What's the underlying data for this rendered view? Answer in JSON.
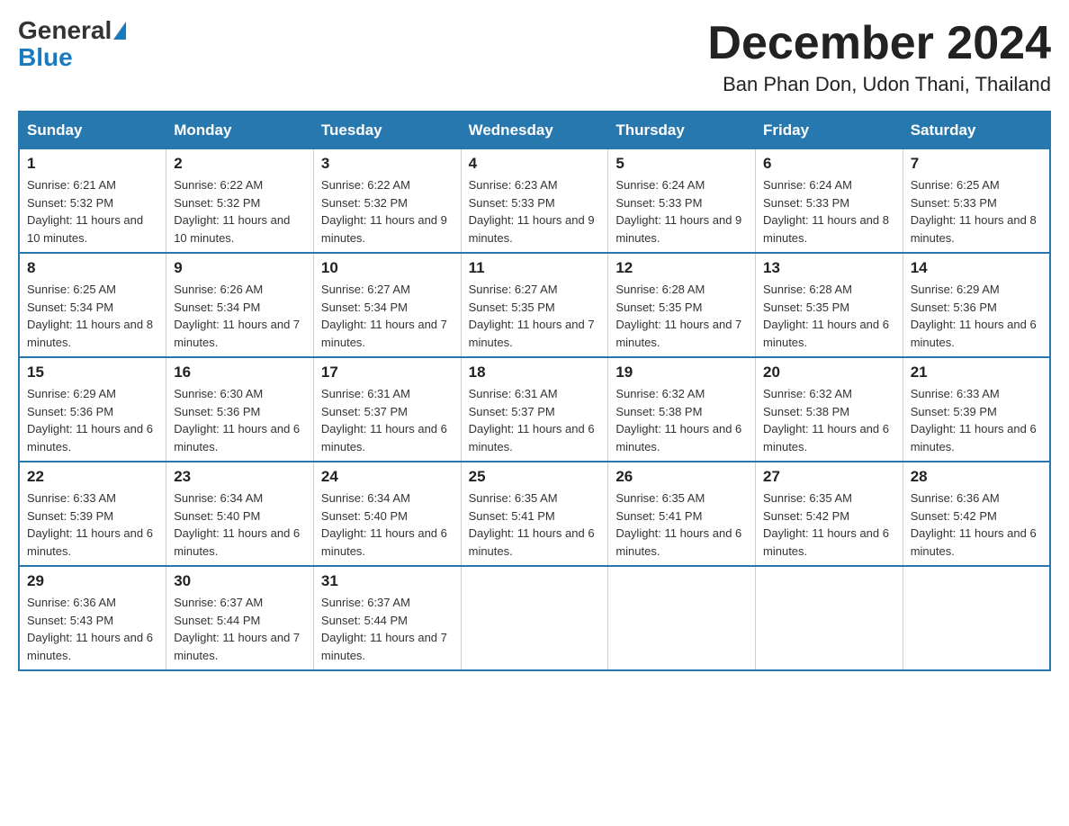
{
  "header": {
    "logo_general": "General",
    "logo_blue": "Blue",
    "title": "December 2024",
    "location": "Ban Phan Don, Udon Thani, Thailand"
  },
  "calendar": {
    "days_of_week": [
      "Sunday",
      "Monday",
      "Tuesday",
      "Wednesday",
      "Thursday",
      "Friday",
      "Saturday"
    ],
    "weeks": [
      [
        {
          "day": "1",
          "sunrise": "6:21 AM",
          "sunset": "5:32 PM",
          "daylight": "11 hours and 10 minutes."
        },
        {
          "day": "2",
          "sunrise": "6:22 AM",
          "sunset": "5:32 PM",
          "daylight": "11 hours and 10 minutes."
        },
        {
          "day": "3",
          "sunrise": "6:22 AM",
          "sunset": "5:32 PM",
          "daylight": "11 hours and 9 minutes."
        },
        {
          "day": "4",
          "sunrise": "6:23 AM",
          "sunset": "5:33 PM",
          "daylight": "11 hours and 9 minutes."
        },
        {
          "day": "5",
          "sunrise": "6:24 AM",
          "sunset": "5:33 PM",
          "daylight": "11 hours and 9 minutes."
        },
        {
          "day": "6",
          "sunrise": "6:24 AM",
          "sunset": "5:33 PM",
          "daylight": "11 hours and 8 minutes."
        },
        {
          "day": "7",
          "sunrise": "6:25 AM",
          "sunset": "5:33 PM",
          "daylight": "11 hours and 8 minutes."
        }
      ],
      [
        {
          "day": "8",
          "sunrise": "6:25 AM",
          "sunset": "5:34 PM",
          "daylight": "11 hours and 8 minutes."
        },
        {
          "day": "9",
          "sunrise": "6:26 AM",
          "sunset": "5:34 PM",
          "daylight": "11 hours and 7 minutes."
        },
        {
          "day": "10",
          "sunrise": "6:27 AM",
          "sunset": "5:34 PM",
          "daylight": "11 hours and 7 minutes."
        },
        {
          "day": "11",
          "sunrise": "6:27 AM",
          "sunset": "5:35 PM",
          "daylight": "11 hours and 7 minutes."
        },
        {
          "day": "12",
          "sunrise": "6:28 AM",
          "sunset": "5:35 PM",
          "daylight": "11 hours and 7 minutes."
        },
        {
          "day": "13",
          "sunrise": "6:28 AM",
          "sunset": "5:35 PM",
          "daylight": "11 hours and 6 minutes."
        },
        {
          "day": "14",
          "sunrise": "6:29 AM",
          "sunset": "5:36 PM",
          "daylight": "11 hours and 6 minutes."
        }
      ],
      [
        {
          "day": "15",
          "sunrise": "6:29 AM",
          "sunset": "5:36 PM",
          "daylight": "11 hours and 6 minutes."
        },
        {
          "day": "16",
          "sunrise": "6:30 AM",
          "sunset": "5:36 PM",
          "daylight": "11 hours and 6 minutes."
        },
        {
          "day": "17",
          "sunrise": "6:31 AM",
          "sunset": "5:37 PM",
          "daylight": "11 hours and 6 minutes."
        },
        {
          "day": "18",
          "sunrise": "6:31 AM",
          "sunset": "5:37 PM",
          "daylight": "11 hours and 6 minutes."
        },
        {
          "day": "19",
          "sunrise": "6:32 AM",
          "sunset": "5:38 PM",
          "daylight": "11 hours and 6 minutes."
        },
        {
          "day": "20",
          "sunrise": "6:32 AM",
          "sunset": "5:38 PM",
          "daylight": "11 hours and 6 minutes."
        },
        {
          "day": "21",
          "sunrise": "6:33 AM",
          "sunset": "5:39 PM",
          "daylight": "11 hours and 6 minutes."
        }
      ],
      [
        {
          "day": "22",
          "sunrise": "6:33 AM",
          "sunset": "5:39 PM",
          "daylight": "11 hours and 6 minutes."
        },
        {
          "day": "23",
          "sunrise": "6:34 AM",
          "sunset": "5:40 PM",
          "daylight": "11 hours and 6 minutes."
        },
        {
          "day": "24",
          "sunrise": "6:34 AM",
          "sunset": "5:40 PM",
          "daylight": "11 hours and 6 minutes."
        },
        {
          "day": "25",
          "sunrise": "6:35 AM",
          "sunset": "5:41 PM",
          "daylight": "11 hours and 6 minutes."
        },
        {
          "day": "26",
          "sunrise": "6:35 AM",
          "sunset": "5:41 PM",
          "daylight": "11 hours and 6 minutes."
        },
        {
          "day": "27",
          "sunrise": "6:35 AM",
          "sunset": "5:42 PM",
          "daylight": "11 hours and 6 minutes."
        },
        {
          "day": "28",
          "sunrise": "6:36 AM",
          "sunset": "5:42 PM",
          "daylight": "11 hours and 6 minutes."
        }
      ],
      [
        {
          "day": "29",
          "sunrise": "6:36 AM",
          "sunset": "5:43 PM",
          "daylight": "11 hours and 6 minutes."
        },
        {
          "day": "30",
          "sunrise": "6:37 AM",
          "sunset": "5:44 PM",
          "daylight": "11 hours and 7 minutes."
        },
        {
          "day": "31",
          "sunrise": "6:37 AM",
          "sunset": "5:44 PM",
          "daylight": "11 hours and 7 minutes."
        },
        null,
        null,
        null,
        null
      ]
    ]
  }
}
